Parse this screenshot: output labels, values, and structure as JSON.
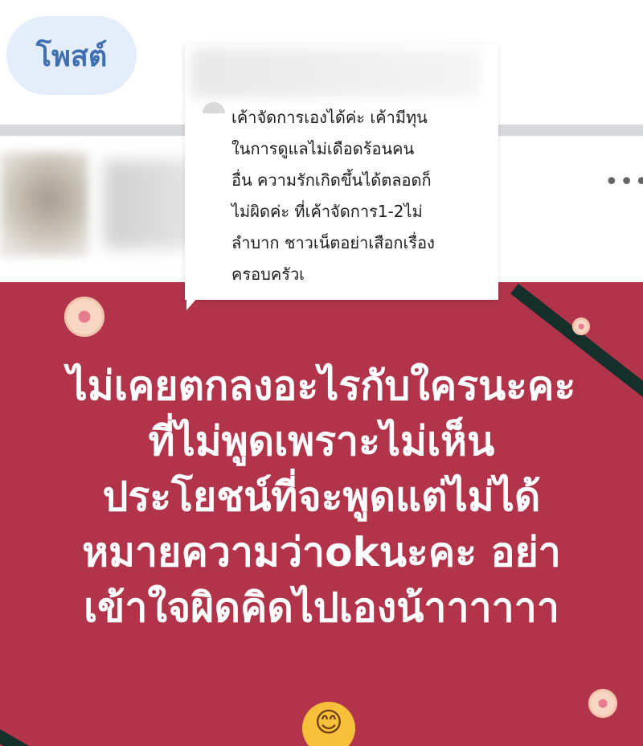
{
  "header": {
    "post_label": "โพสต์"
  },
  "post": {
    "more_label": "•••"
  },
  "comment": {
    "lines": [
      "เค้าจัดการเองได้ค่ะ เค้ามีทุน",
      "ในการดูแลไม่เดือดร้อนคน",
      "อื่น ความรักเกิดขึ้นได้ตลอดก็",
      "ไม่ผิดค่ะ ที่เค้าจัดการ1-2ไม่",
      "ลำบาก ชาวเน็ตอย่าเสือกเรื่อง",
      "ครอบครัวเ"
    ]
  },
  "image_text": {
    "lines": [
      "ไม่เคยตกลงอะไรกับใครนะคะ",
      "ที่ไม่พูดเพราะไม่เห็น",
      "ประโยชน์ที่จะพูดแต่ไม่ได้",
      "หมายความว่าokนะคะ อย่า",
      "เข้าใจผิดคิดไปเองน้าาาาาา"
    ],
    "emoji": "😊"
  },
  "colors": {
    "post_button_bg": "#e4eefa",
    "post_button_text": "#3f6fb0",
    "image_bg": "#b1344a",
    "stripe": "#15302a"
  }
}
